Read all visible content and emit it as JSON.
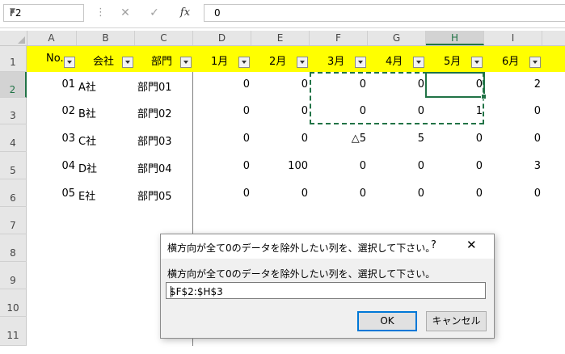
{
  "formula_bar": {
    "name_box": "F2",
    "cancel_icon": "✕",
    "enter_icon": "✓",
    "fx_label": "fx",
    "formula_value": "0"
  },
  "columns": [
    "A",
    "B",
    "C",
    "D",
    "E",
    "F",
    "G",
    "H",
    "I"
  ],
  "rows": [
    "1",
    "2",
    "3",
    "4",
    "5",
    "6",
    "7",
    "8",
    "9",
    "10",
    "11"
  ],
  "header_row": {
    "no": "No.",
    "company": "会社",
    "dept": "部門",
    "m1": "1月",
    "m2": "2月",
    "m3": "3月",
    "m4": "4月",
    "m5": "5月",
    "m6": "6月"
  },
  "data_rows": [
    {
      "no": "01",
      "company": "A社",
      "dept": "部門01",
      "m1": "0",
      "m2": "0",
      "m3": "0",
      "m4": "0",
      "m5": "0",
      "m6": "2"
    },
    {
      "no": "02",
      "company": "B社",
      "dept": "部門02",
      "m1": "0",
      "m2": "0",
      "m3": "0",
      "m4": "0",
      "m5": "1",
      "m6": "0"
    },
    {
      "no": "03",
      "company": "C社",
      "dept": "部門03",
      "m1": "0",
      "m2": "0",
      "m3": "△5",
      "m4": "5",
      "m5": "0",
      "m6": "0"
    },
    {
      "no": "04",
      "company": "D社",
      "dept": "部門04",
      "m1": "0",
      "m2": "100",
      "m3": "0",
      "m4": "0",
      "m5": "0",
      "m6": "3"
    },
    {
      "no": "05",
      "company": "E社",
      "dept": "部門05",
      "m1": "0",
      "m2": "0",
      "m3": "0",
      "m4": "0",
      "m5": "0",
      "m6": "0"
    }
  ],
  "dialog": {
    "title": "横方向が全て0のデータを除外したい列を、選択して下さい。",
    "help": "?",
    "close": "✕",
    "prompt": "横方向が全て0のデータを除外したい列を、選択して下さい。",
    "input_value": "$F$2:$H$3",
    "ok": "OK",
    "cancel": "キャンセル"
  },
  "colors": {
    "header_fill": "#ffff00",
    "selection_green": "#217346"
  }
}
